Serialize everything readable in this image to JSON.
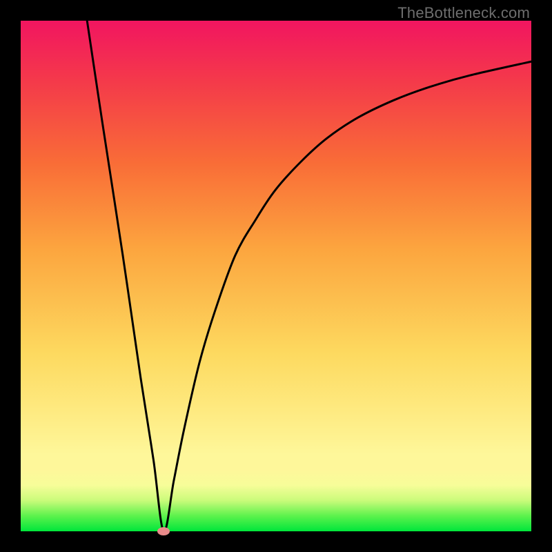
{
  "attribution": "TheBottleneck.com",
  "colors": {
    "frame_bg": "#000000",
    "gradient_top": "#f21560",
    "gradient_bottom": "#00e63b",
    "curve_stroke": "#000000",
    "marker_fill": "#e98b8a"
  },
  "chart_data": {
    "type": "line",
    "title": "",
    "xlabel": "",
    "ylabel": "",
    "xlim": [
      0,
      100
    ],
    "ylim": [
      0,
      100
    ],
    "grid": false,
    "legend": false,
    "marker": {
      "x": 28,
      "y": 0
    },
    "series": [
      {
        "name": "bottleneck-curve",
        "x": [
          13,
          16,
          20,
          23.5,
          26,
          28,
          30,
          32,
          35,
          38,
          42,
          46,
          50,
          55,
          60,
          66,
          73,
          80,
          88,
          100
        ],
        "y": [
          100,
          80,
          54,
          30,
          14,
          0,
          10,
          20,
          33,
          43,
          54,
          61,
          67,
          72.5,
          77,
          81,
          84.4,
          87,
          89.3,
          92
        ]
      }
    ]
  }
}
